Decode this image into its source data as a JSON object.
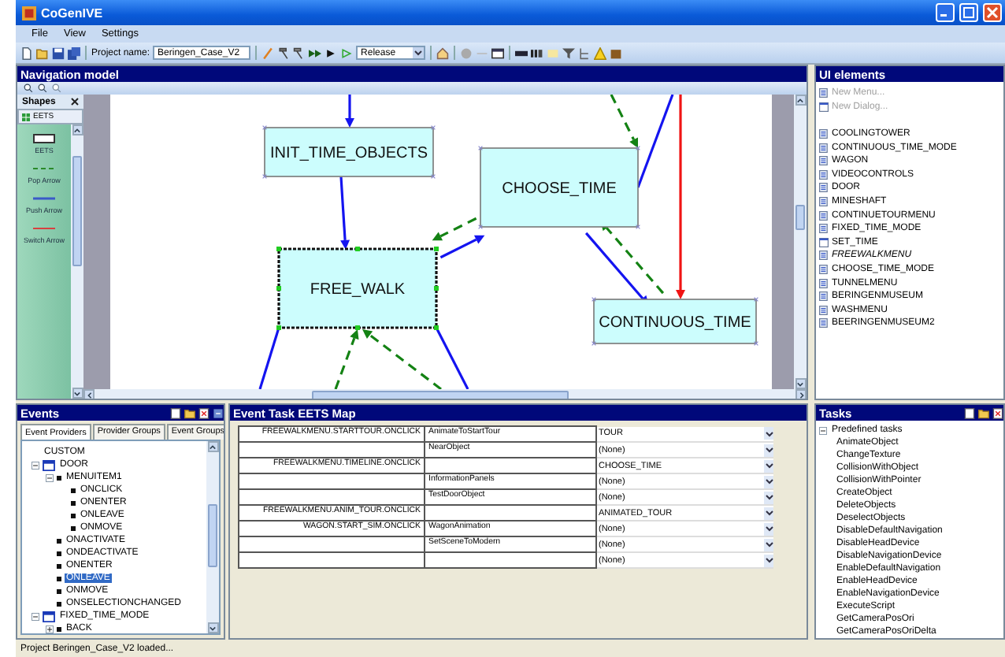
{
  "window": {
    "title": "CoGenIVE"
  },
  "menu": [
    "File",
    "View",
    "Settings"
  ],
  "toolbar": {
    "project_label": "Project name:",
    "project_name": "Beringen_Case_V2",
    "configuration": "Release"
  },
  "navigation_model": {
    "title": "Navigation model",
    "shapes": {
      "title": "Shapes",
      "group": "EETS",
      "items": [
        {
          "label": "EETS",
          "kind": "eets"
        },
        {
          "label": "Pop Arrow",
          "kind": "pop"
        },
        {
          "label": "Push Arrow",
          "kind": "push"
        },
        {
          "label": "Switch Arrow",
          "kind": "switch"
        }
      ]
    },
    "nodes": [
      {
        "label": "INIT_TIME_OBJECTS",
        "selected": false
      },
      {
        "label": "CHOOSE_TIME",
        "selected": false
      },
      {
        "label": "FREE_WALK",
        "selected": true
      },
      {
        "label": "CONTINUOUS_TIME",
        "selected": false
      }
    ]
  },
  "ui_elements": {
    "title": "UI elements",
    "actions": [
      {
        "label": "New Menu...",
        "kind": "menu",
        "disabled": true
      },
      {
        "label": "New Dialog...",
        "kind": "dialog",
        "disabled": true
      }
    ],
    "items": [
      {
        "label": "COOLINGTOWER",
        "kind": "menu",
        "current": false
      },
      {
        "label": "CONTINUOUS_TIME_MODE",
        "kind": "menu",
        "current": false
      },
      {
        "label": "WAGON",
        "kind": "menu",
        "current": false
      },
      {
        "label": "VIDEOCONTROLS",
        "kind": "menu",
        "current": false
      },
      {
        "label": "DOOR",
        "kind": "menu",
        "current": false
      },
      {
        "label": "MINESHAFT",
        "kind": "menu",
        "current": false
      },
      {
        "label": "CONTINUETOURMENU",
        "kind": "menu",
        "current": false
      },
      {
        "label": "FIXED_TIME_MODE",
        "kind": "menu",
        "current": false
      },
      {
        "label": "SET_TIME",
        "kind": "dialog",
        "current": false
      },
      {
        "label": "FREEWALKMENU",
        "kind": "menu",
        "current": true
      },
      {
        "label": "CHOOSE_TIME_MODE",
        "kind": "menu",
        "current": false
      },
      {
        "label": "TUNNELMENU",
        "kind": "menu",
        "current": false
      },
      {
        "label": "BERINGENMUSEUM",
        "kind": "menu",
        "current": false
      },
      {
        "label": "WASHMENU",
        "kind": "menu",
        "current": false
      },
      {
        "label": "BEERINGENMUSEUM2",
        "kind": "menu",
        "current": false
      }
    ]
  },
  "events": {
    "title": "Events",
    "tabs": [
      {
        "label": "Event Providers",
        "selected": true
      },
      {
        "label": "Provider Groups",
        "selected": false
      },
      {
        "label": "Event Groups",
        "selected": false
      }
    ],
    "tree": [
      {
        "label": "CUSTOM",
        "kind": "plain",
        "selected": false
      },
      {
        "label": "DOOR",
        "kind": "provider",
        "selected": false,
        "expanded": true,
        "children": [
          {
            "label": "MENUITEM1",
            "kind": "event",
            "selected": false,
            "expanded": true,
            "children": [
              {
                "label": "ONCLICK",
                "kind": "event",
                "selected": false
              },
              {
                "label": "ONENTER",
                "kind": "event",
                "selected": false
              },
              {
                "label": "ONLEAVE",
                "kind": "event",
                "selected": false
              },
              {
                "label": "ONMOVE",
                "kind": "event",
                "selected": false
              }
            ]
          },
          {
            "label": "ONACTIVATE",
            "kind": "event",
            "selected": false
          },
          {
            "label": "ONDEACTIVATE",
            "kind": "event",
            "selected": false
          },
          {
            "label": "ONENTER",
            "kind": "event",
            "selected": false
          },
          {
            "label": "ONLEAVE",
            "kind": "event",
            "selected": true
          },
          {
            "label": "ONMOVE",
            "kind": "event",
            "selected": false
          },
          {
            "label": "ONSELECTIONCHANGED",
            "kind": "event",
            "selected": false
          }
        ]
      },
      {
        "label": "FIXED_TIME_MODE",
        "kind": "provider",
        "selected": false,
        "expanded": true,
        "children": [
          {
            "label": "BACK",
            "kind": "event",
            "selected": false,
            "expanded": false
          }
        ]
      }
    ]
  },
  "event_task_map": {
    "title": "Event Task EETS Map",
    "rows": [
      {
        "event": "FREEWALKMENU.STARTTOUR.ONCLICK",
        "task": "AnimateToStartTour",
        "eets": "TOUR"
      },
      {
        "task": "NearObject",
        "eets": "(None)"
      },
      {
        "event": "FREEWALKMENU.TIMELINE.ONCLICK",
        "eets": "CHOOSE_TIME"
      },
      {
        "task": "InformationPanels",
        "eets": "(None)"
      },
      {
        "task": "TestDoorObject",
        "eets": "(None)"
      },
      {
        "event": "FREEWALKMENU.ANIM_TOUR.ONCLICK",
        "eets": "ANIMATED_TOUR"
      },
      {
        "event": "WAGON.START_SIM.ONCLICK",
        "task": "WagonAnimation",
        "eets": "(None)"
      },
      {
        "task": "SetSceneToModern",
        "eets": "(None)"
      },
      {
        "eets": "(None)"
      }
    ]
  },
  "tasks": {
    "title": "Tasks",
    "tree": [
      {
        "label": "Predefined tasks",
        "expanded": true,
        "children": [
          {
            "label": "AnimateObject"
          },
          {
            "label": "ChangeTexture"
          },
          {
            "label": "CollisionWithObject"
          },
          {
            "label": "CollisionWithPointer"
          },
          {
            "label": "CreateObject"
          },
          {
            "label": "DeleteObjects"
          },
          {
            "label": "DeselectObjects"
          },
          {
            "label": "DisableDefaultNavigation"
          },
          {
            "label": "DisableHeadDevice"
          },
          {
            "label": "DisableNavigationDevice"
          },
          {
            "label": "EnableDefaultNavigation"
          },
          {
            "label": "EnableHeadDevice"
          },
          {
            "label": "EnableNavigationDevice"
          },
          {
            "label": "ExecuteScript"
          },
          {
            "label": "GetCameraPosOri"
          },
          {
            "label": "GetCameraPosOriDelta"
          }
        ]
      }
    ]
  },
  "status_bar": "Project Beringen_Case_V2 loaded..."
}
